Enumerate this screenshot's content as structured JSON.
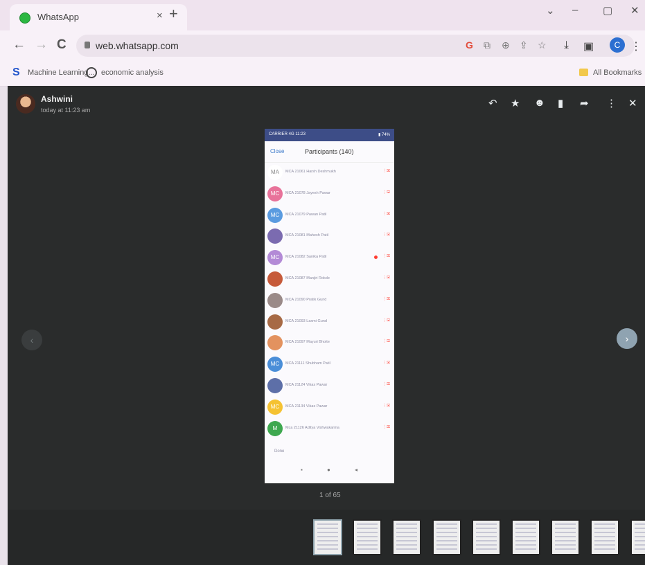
{
  "browser": {
    "tab_title": "WhatsApp",
    "tab_close": "×",
    "new_tab": "+",
    "controls": {
      "dropdown": "⌄",
      "minimize": "–",
      "maximize": "▢",
      "close": "✕"
    },
    "nav": {
      "back": "←",
      "forward": "→",
      "reload": "C"
    },
    "url": "web.whatsapp.com",
    "ext_icons": [
      "G",
      "⧉",
      "⊕",
      "⇪",
      "☆",
      "⤓",
      "▣"
    ],
    "profile_initial": "C",
    "menu": "⋮"
  },
  "bookmarks": {
    "items": [
      {
        "label": "Machine Learning..."
      },
      {
        "label": "economic analysis"
      }
    ],
    "all_bookmarks": "All Bookmarks"
  },
  "viewer": {
    "sender_name": "Ashwini",
    "sent_time": "today at 11:23 am",
    "toolbar": {
      "reply": "↶",
      "star": "★",
      "react": "☻",
      "delete": "▮",
      "forward": "➦",
      "menu": "⋮",
      "close": "✕"
    },
    "prev": "‹",
    "next": "›",
    "counter": "1 of 65",
    "thumbnail_count": 9
  },
  "phone": {
    "status_left": "CARRIER 4G 11:23",
    "status_right": "▮ 74%",
    "close": "Close",
    "title": "Participants (140)",
    "done": "Done",
    "nav_buttons": [
      "▪",
      "●",
      "◂"
    ],
    "rows": [
      {
        "initials": "MA",
        "color": "#ffffff",
        "name": "MCA 21061 Harsh Deshmukh",
        "dot": false
      },
      {
        "initials": "MC",
        "color": "#e8729a",
        "name": "MCA 21078 Jayesh Pawar",
        "dot": false
      },
      {
        "initials": "MC",
        "color": "#5a9be0",
        "name": "MCA 21079 Pawan Patil",
        "dot": false
      },
      {
        "initials": "",
        "color": "#7b6bb0",
        "name": "MCA 21081 Mahesh Patil",
        "dot": false
      },
      {
        "initials": "MC",
        "color": "#b38ad6",
        "name": "MCA 21082 Sanika Patil",
        "dot": true
      },
      {
        "initials": "",
        "color": "#c65a3a",
        "name": "MCA 21087 Manjiri Rokde",
        "dot": false
      },
      {
        "initials": "",
        "color": "#9a8a88",
        "name": "MCA 21090 Pratik Gund",
        "dot": false
      },
      {
        "initials": "",
        "color": "#a76a45",
        "name": "MCA 21093 Laxmi Gund",
        "dot": false
      },
      {
        "initials": "",
        "color": "#e3925f",
        "name": "MCA 21097 Mayuri Bhoite",
        "dot": false
      },
      {
        "initials": "MC",
        "color": "#4a8ed8",
        "name": "MCA 21111 Shubham Patil",
        "dot": false
      },
      {
        "initials": "",
        "color": "#5d6fa8",
        "name": "MCA 21124 Vikas Pawar",
        "dot": false
      },
      {
        "initials": "MC",
        "color": "#f5c232",
        "name": "MCA 21134 Vikas Pawar",
        "dot": false
      },
      {
        "initials": "M",
        "color": "#3ea84f",
        "name": "Mca 21126 Aditya Vishwakarma",
        "dot": false
      }
    ]
  }
}
